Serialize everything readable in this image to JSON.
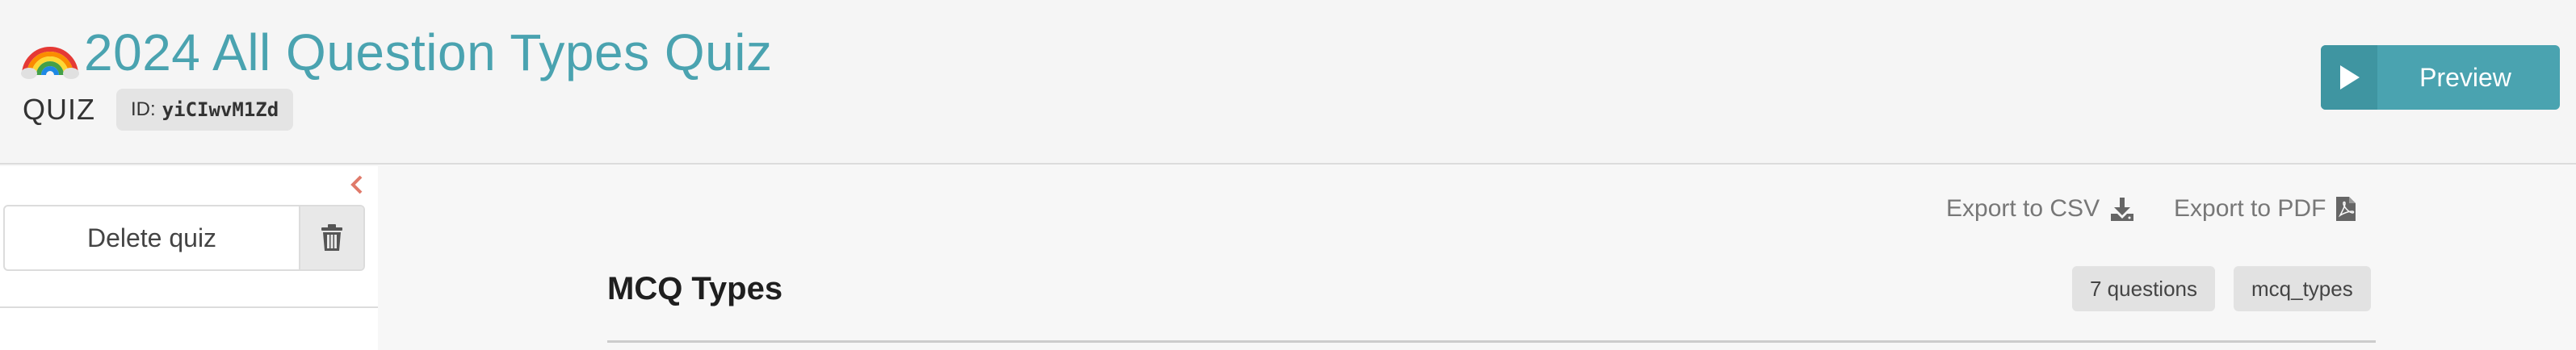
{
  "header": {
    "emoji": "🌈",
    "title": "2024 All Question Types Quiz",
    "type_label": "QUIZ",
    "id_label": "ID:",
    "id_value": "yiCIwvM1Zd",
    "preview_label": "Preview"
  },
  "sidebar": {
    "delete_label": "Delete quiz",
    "icons": [
      "chevron-left-icon",
      "trash-icon"
    ]
  },
  "main": {
    "export_csv_label": "Export to CSV",
    "export_pdf_label": "Export to PDF",
    "section": {
      "title": "MCQ Types",
      "count_badge": "7 questions",
      "slug_badge": "mcq_types"
    }
  },
  "colors": {
    "accent": "#4aa3b0",
    "accent_dark": "#3f95a1",
    "collapse_arrow": "#e07a6a"
  }
}
